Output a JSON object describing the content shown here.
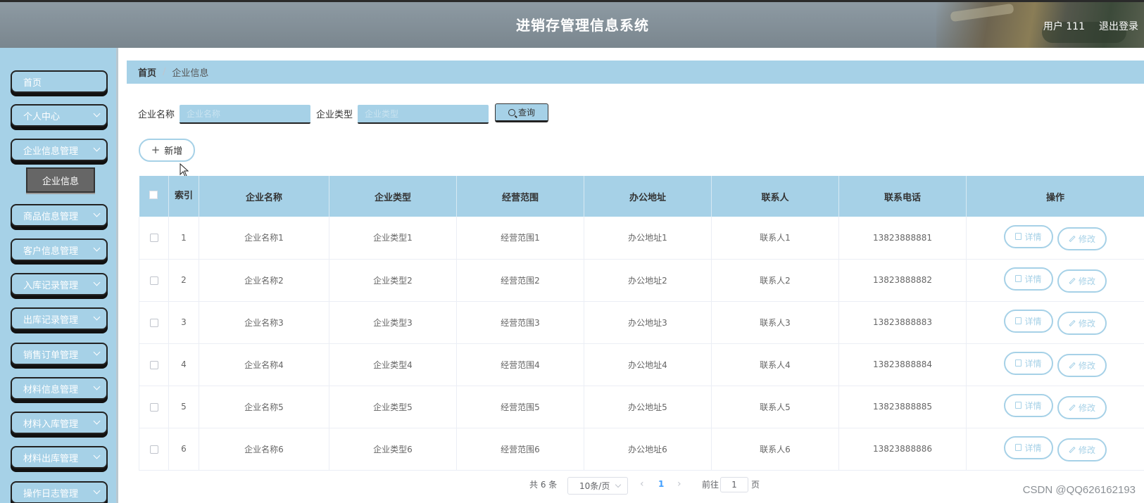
{
  "header": {
    "title": "进销存管理信息系统",
    "user_label": "用户 111",
    "logout_label": "退出登录"
  },
  "sidebar": {
    "items": [
      {
        "label": "首页",
        "has_children": false
      },
      {
        "label": "个人中心",
        "has_children": true
      },
      {
        "label": "企业信息管理",
        "has_children": true
      },
      {
        "label": "商品信息管理",
        "has_children": true
      },
      {
        "label": "客户信息管理",
        "has_children": true
      },
      {
        "label": "入库记录管理",
        "has_children": true
      },
      {
        "label": "出库记录管理",
        "has_children": true
      },
      {
        "label": "销售订单管理",
        "has_children": true
      },
      {
        "label": "材料信息管理",
        "has_children": true
      },
      {
        "label": "材料入库管理",
        "has_children": true
      },
      {
        "label": "材料出库管理",
        "has_children": true
      },
      {
        "label": "操作日志管理",
        "has_children": true
      }
    ],
    "active_submenu": "企业信息"
  },
  "breadcrumb": {
    "home": "首页",
    "current": "企业信息"
  },
  "search": {
    "name_label": "企业名称",
    "name_placeholder": "企业名称",
    "name_value": "",
    "type_label": "企业类型",
    "type_placeholder": "企业类型",
    "type_value": "",
    "button_label": "查询"
  },
  "actions": {
    "add_label": "新增"
  },
  "table": {
    "columns": [
      "索引",
      "企业名称",
      "企业类型",
      "经营范围",
      "办公地址",
      "联系人",
      "联系电话",
      "操作"
    ],
    "rows": [
      {
        "index": "1",
        "name": "企业名称1",
        "type": "企业类型1",
        "scope": "经营范围1",
        "address": "办公地址1",
        "contact": "联系人1",
        "phone": "13823888881"
      },
      {
        "index": "2",
        "name": "企业名称2",
        "type": "企业类型2",
        "scope": "经营范围2",
        "address": "办公地址2",
        "contact": "联系人2",
        "phone": "13823888882"
      },
      {
        "index": "3",
        "name": "企业名称3",
        "type": "企业类型3",
        "scope": "经营范围3",
        "address": "办公地址3",
        "contact": "联系人3",
        "phone": "13823888883"
      },
      {
        "index": "4",
        "name": "企业名称4",
        "type": "企业类型4",
        "scope": "经营范围4",
        "address": "办公地址4",
        "contact": "联系人4",
        "phone": "13823888884"
      },
      {
        "index": "5",
        "name": "企业名称5",
        "type": "企业类型5",
        "scope": "经营范围5",
        "address": "办公地址5",
        "contact": "联系人5",
        "phone": "13823888885"
      },
      {
        "index": "6",
        "name": "企业名称6",
        "type": "企业类型6",
        "scope": "经营范围6",
        "address": "办公地址6",
        "contact": "联系人6",
        "phone": "13823888886"
      }
    ],
    "detail_label": "详情",
    "edit_label": "修改"
  },
  "pagination": {
    "total_text": "共 6 条",
    "page_size": "10条/页",
    "current_page": "1",
    "goto_label": "前往",
    "goto_value": "1",
    "page_suffix": "页"
  },
  "watermark": "CSDN @QQ626162193",
  "colors": {
    "accent": "#a6d1e7",
    "header_bg": "#8d9aa3",
    "active_submenu_bg": "#666666"
  }
}
